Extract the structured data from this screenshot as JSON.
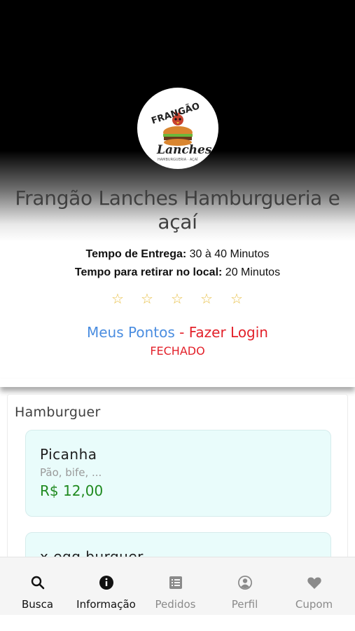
{
  "store": {
    "name": "Frangão Lanches Hamburgueria e açaí",
    "logo_text_top": "FRANGÃO",
    "logo_text_bottom": "Lanches",
    "logo_text_small": "HAMBURGUERIA · AÇAÍ"
  },
  "delivery": {
    "label": "Tempo de Entrega:",
    "value": "30 à 40 Minutos"
  },
  "pickup": {
    "label": "Tempo para retirar no local:",
    "value": "20 Minutos"
  },
  "rating": {
    "stars": 5,
    "filled": 0,
    "star_color": "#e8c14a"
  },
  "loyalty": {
    "points_label": "Meus Pontos",
    "login_label": "- Fazer Login",
    "status": "FECHADO"
  },
  "menu": {
    "category": "Hamburguer",
    "products": [
      {
        "name": "Picanha",
        "description": "Pão, bife, ...",
        "price": "R$ 12,00"
      },
      {
        "name": "x egg burguer",
        "description": "",
        "price": ""
      }
    ]
  },
  "nav": {
    "items": [
      {
        "label": "Busca",
        "icon": "search-icon",
        "active": true
      },
      {
        "label": "Informação",
        "icon": "info-icon",
        "active": true
      },
      {
        "label": "Pedidos",
        "icon": "list-icon",
        "active": false
      },
      {
        "label": "Perfil",
        "icon": "profile-icon",
        "active": false
      },
      {
        "label": "Cupom",
        "icon": "heart-icon",
        "active": false
      }
    ]
  },
  "colors": {
    "accent_blue": "#4a8de0",
    "accent_red": "#e3222b",
    "price_green": "#1f8a1f",
    "card_bg": "#e9fcfb"
  }
}
